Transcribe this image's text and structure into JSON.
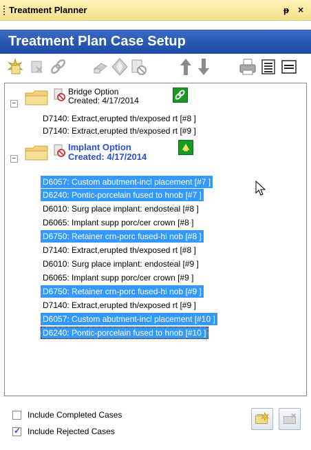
{
  "window": {
    "title": "Treatment Planner",
    "pin_glyph": "ᵖ",
    "close_glyph": "×"
  },
  "header": {
    "title": "Treatment Plan Case Setup"
  },
  "toolbar": {
    "buttons": [
      {
        "name": "new-case-icon"
      },
      {
        "name": "delete-case-icon"
      },
      {
        "name": "link-icon"
      },
      {
        "name": "move-right-icon"
      },
      {
        "name": "diamond-arrows-icon"
      },
      {
        "name": "reject-icon"
      },
      {
        "name": "move-up-icon"
      },
      {
        "name": "move-down-icon"
      },
      {
        "name": "print-icon"
      },
      {
        "name": "report-icon"
      },
      {
        "name": "collapse-icon"
      }
    ]
  },
  "tree": {
    "options": [
      {
        "name": "Bridge Option",
        "created": "Created: 4/17/2014",
        "bold": false,
        "expander": "−",
        "items": [
          {
            "text": "D7140: Extract,erupted th/exposed rt [#8 ]",
            "selected": false
          },
          {
            "text": "D7140: Extract,erupted th/exposed rt [#9 ]",
            "selected": false
          }
        ]
      },
      {
        "name": "Implant Option",
        "created": "Created: 4/17/2014",
        "bold": true,
        "expander": "−",
        "items": [
          {
            "text": "D6057: Custom abutment-incl placement [#7 ]",
            "selected": true
          },
          {
            "text": "D6240: Pontic-porcelain fused to hnob [#7 ]",
            "selected": true
          },
          {
            "text": "D6010: Surg place implant: endosteal [#8 ]",
            "selected": false
          },
          {
            "text": "D6065: Implant supp porc/cer crown [#8 ]",
            "selected": false
          },
          {
            "text": "D6750: Retainer crn-porc fused-hi nob [#8 ]",
            "selected": true
          },
          {
            "text": "D7140: Extract,erupted th/exposed rt [#8 ]",
            "selected": false
          },
          {
            "text": "D6010: Surg place implant: endosteal [#9 ]",
            "selected": false
          },
          {
            "text": "D6065: Implant supp porc/cer crown [#9 ]",
            "selected": false
          },
          {
            "text": "D6750: Retainer crn-porc fused-hi nob [#9 ]",
            "selected": true
          },
          {
            "text": "D7140: Extract,erupted th/exposed rt [#9 ]",
            "selected": false
          },
          {
            "text": "D6057: Custom abutment-incl placement [#10 ]",
            "selected": true
          },
          {
            "text": "D6240: Pontic-porcelain fused to hnob [#10 ]",
            "selected": true,
            "focused": true
          }
        ]
      }
    ]
  },
  "footer": {
    "include_completed": {
      "label": "Include Completed Cases",
      "checked": false
    },
    "include_rejected": {
      "label": "Include Rejected Cases",
      "checked": true
    },
    "buttons": [
      {
        "name": "open-case-icon"
      },
      {
        "name": "close-case-icon"
      }
    ]
  },
  "colors": {
    "header_bg": "#2456b3",
    "title_bg": "#f9e79f",
    "selection": "#3399ff",
    "implant_title": "#2b4fd6",
    "green_badge": "#179a22"
  }
}
